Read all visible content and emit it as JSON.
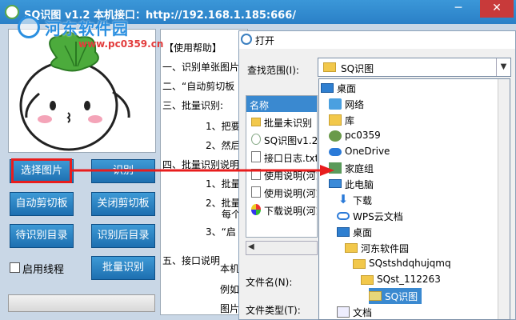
{
  "app": {
    "title": "SQ识图 v1.2    本机接口：http://192.168.1.185:666/"
  },
  "watermark": {
    "text": "河东软件园",
    "url": "www.pc0359.cn"
  },
  "buttons": {
    "select_image": "选择图片",
    "recognize": "识别",
    "auto_clipboard": "自动剪切板",
    "close_clipboard": "关闭剪切板",
    "pending_dir": "待识别目录",
    "done_dir": "识别后目录",
    "batch_recognize": "批量识别"
  },
  "thread_checkbox": {
    "label": "启用线程",
    "checked": false
  },
  "help": {
    "lines": [
      "【使用帮助】",
      "一、识别单张图片",
      "二、“自动剪切板",
      "三、批量识别:",
      "1、把要",
      "2、然后",
      "四、批量识别说明",
      "1、批量",
      "2、批量",
      "每个",
      "3、“启",
      "五、接口说明",
      "本机",
      "例如",
      "图片"
    ]
  },
  "dialog": {
    "title": "打开",
    "lookin_label": "查找范围(I):",
    "lookin_value": "SQ识图",
    "column_name": "名称",
    "files": [
      {
        "name": "批量未识别",
        "type": "folder"
      },
      {
        "name": "SQ识图v1.2.",
        "type": "exe"
      },
      {
        "name": "接口日志.txt",
        "type": "txt"
      },
      {
        "name": "使用说明(河东",
        "type": "doc"
      },
      {
        "name": "使用说明(河东",
        "type": "doc"
      },
      {
        "name": "下载说明(河东",
        "type": "dl"
      }
    ],
    "filename_label": "文件名(N):",
    "filetype_label": "文件类型(T):"
  },
  "tree": {
    "nodes": [
      {
        "label": "桌面",
        "icon": "desktop-icon"
      },
      {
        "label": "网络",
        "icon": "network-icon"
      },
      {
        "label": "库",
        "icon": "library-icon"
      },
      {
        "label": "pc0359",
        "icon": "user-icon"
      },
      {
        "label": "OneDrive",
        "icon": "cloud-icon"
      },
      {
        "label": "家庭组",
        "icon": "homegroup-icon"
      },
      {
        "label": "此电脑",
        "icon": "computer-icon"
      },
      {
        "label": "下载",
        "icon": "download-icon"
      },
      {
        "label": "WPS云文档",
        "icon": "wps-cloud-icon"
      },
      {
        "label": "桌面",
        "icon": "desktop-folder-icon"
      },
      {
        "label": "河东软件园",
        "icon": "folder-icon"
      },
      {
        "label": "SQstshdqhujqmq",
        "icon": "folder-icon"
      },
      {
        "label": "SQst_112263",
        "icon": "folder-icon"
      },
      {
        "label": "SQ识图",
        "icon": "folder-icon",
        "selected": true
      },
      {
        "label": "文档",
        "icon": "documents-icon"
      }
    ]
  },
  "colors": {
    "button": "#2a84c8",
    "title_bar": "#2a80c7",
    "selection": "#3a89d0",
    "highlight": "#e81d1d"
  }
}
